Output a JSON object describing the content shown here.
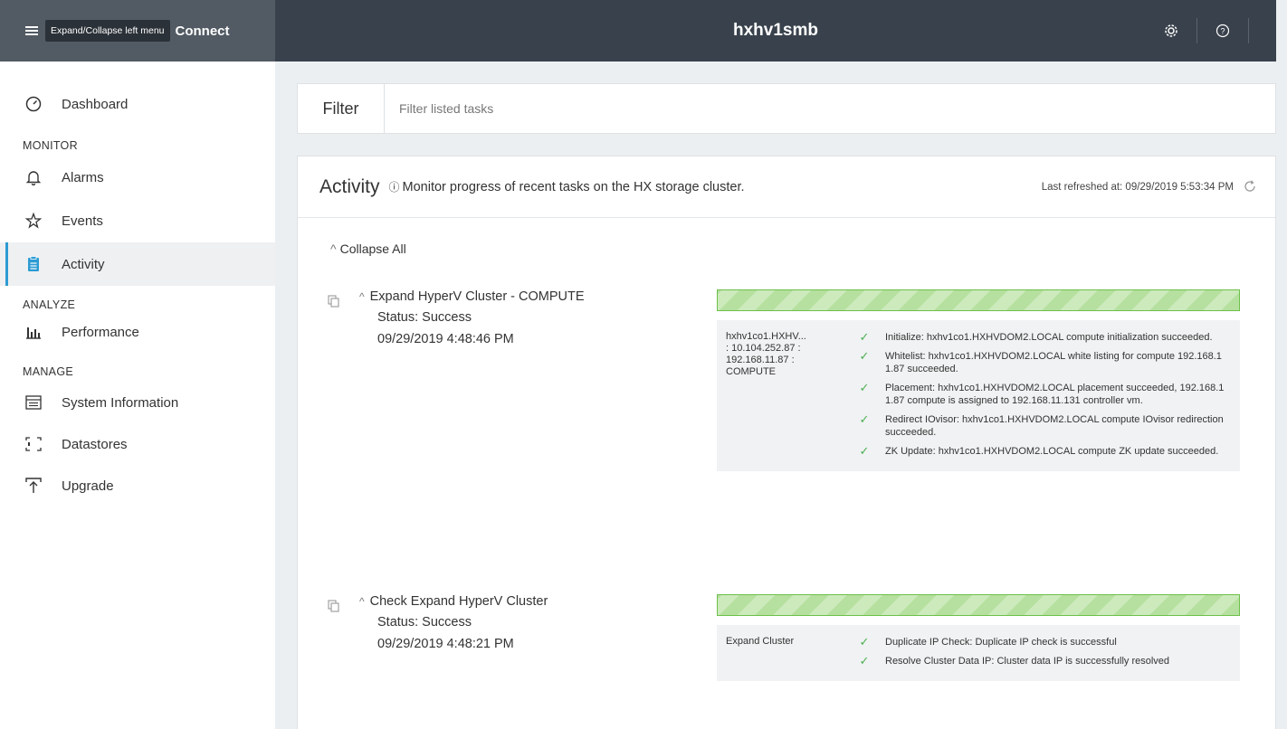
{
  "topbar": {
    "tooltip": "Expand/Collapse left menu",
    "brand": "Connect",
    "cluster_name": "hxhv1smb"
  },
  "sidebar": {
    "dashboard": "Dashboard",
    "sections": {
      "monitor": "MONITOR",
      "analyze": "ANALYZE",
      "manage": "MANAGE"
    },
    "items": {
      "alarms": "Alarms",
      "events": "Events",
      "activity": "Activity",
      "performance": "Performance",
      "system_information": "System Information",
      "datastores": "Datastores",
      "upgrade": "Upgrade"
    },
    "active": "Activity"
  },
  "filter": {
    "label": "Filter",
    "placeholder": "Filter listed tasks",
    "value": ""
  },
  "activity": {
    "title": "Activity",
    "description": "Monitor progress of recent tasks on the HX storage cluster.",
    "last_refreshed": "Last refreshed at: 09/29/2019 5:53:34 PM",
    "collapse_all": "Collapse All",
    "tasks": [
      {
        "name": "Expand HyperV Cluster - COMPUTE",
        "status": "Status: Success",
        "time": "09/29/2019 4:48:46 PM",
        "progress_pct": 100,
        "host_lines": [
          "hxhv1co1.HXHV...",
          ": 10.104.252.87 :",
          "192.168.11.87 :",
          "COMPUTE"
        ],
        "steps": [
          "Initialize: hxhv1co1.HXHVDOM2.LOCAL compute initialization succeeded.",
          "Whitelist: hxhv1co1.HXHVDOM2.LOCAL white listing for compute 192.168.11.87 succeeded.",
          "Placement: hxhv1co1.HXHVDOM2.LOCAL placement succeeded, 192.168.11.87 compute is assigned to 192.168.11.131 controller vm.",
          "Redirect IOvisor: hxhv1co1.HXHVDOM2.LOCAL compute IOvisor redirection succeeded.",
          "ZK Update: hxhv1co1.HXHVDOM2.LOCAL compute ZK update succeeded."
        ]
      },
      {
        "name": "Check Expand HyperV Cluster",
        "status": "Status: Success",
        "time": "09/29/2019 4:48:21 PM",
        "progress_pct": 100,
        "host_lines": [
          "Expand Cluster"
        ],
        "steps": [
          "Duplicate IP Check: Duplicate IP check is successful",
          "Resolve Cluster Data IP: Cluster data IP is successfully resolved"
        ]
      }
    ]
  }
}
